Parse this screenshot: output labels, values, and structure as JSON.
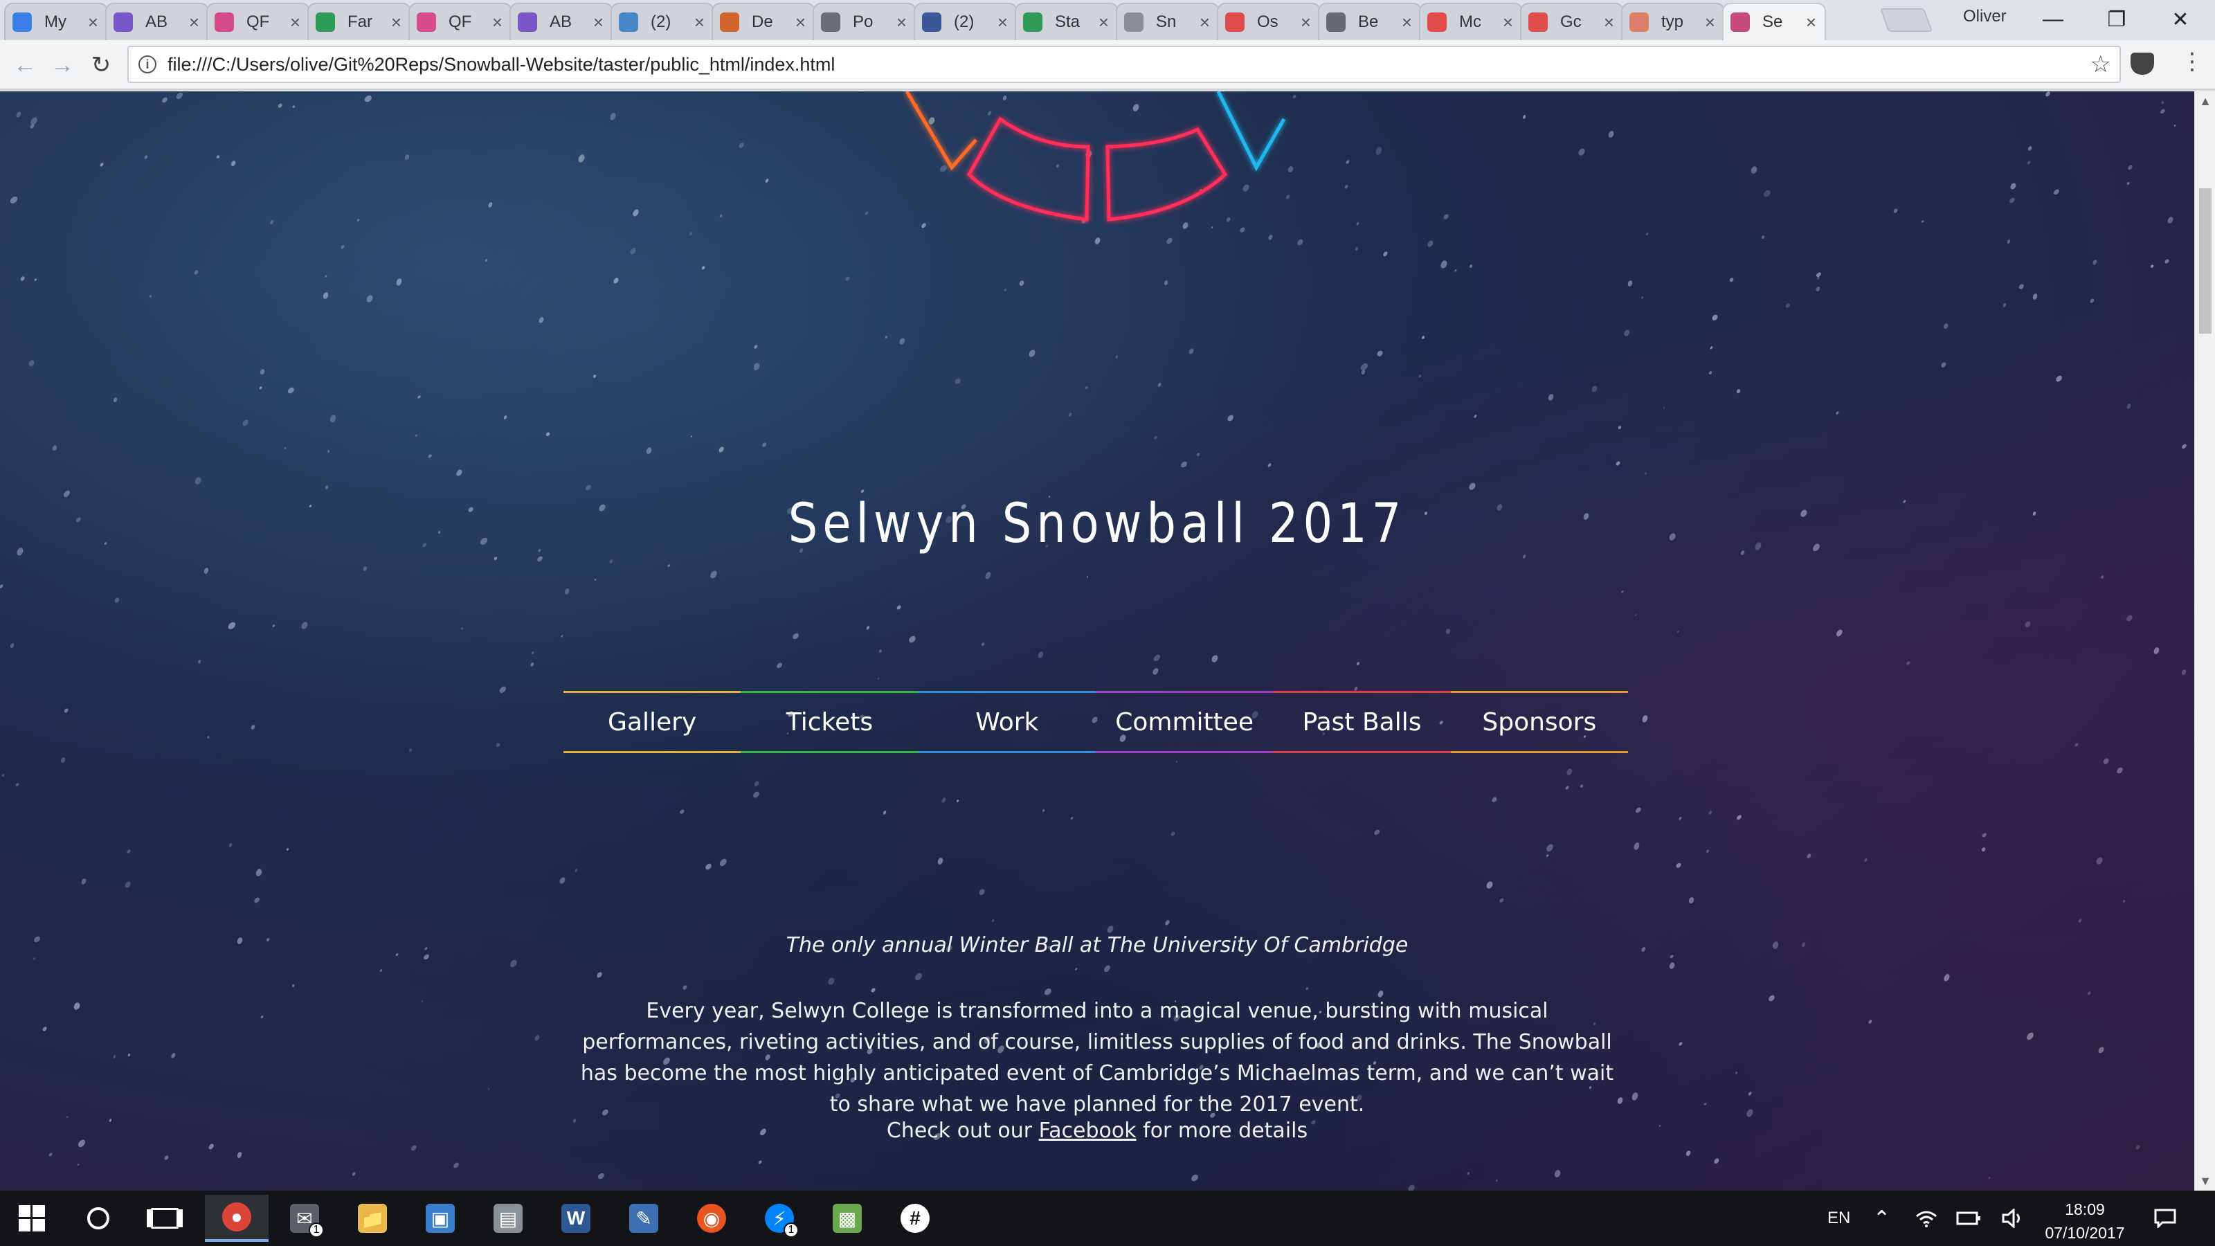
{
  "browser": {
    "tabs": [
      {
        "label": "My",
        "icon": "drive-icon",
        "color": "#3a7ee8"
      },
      {
        "label": "AB",
        "icon": "forms-icon",
        "color": "#7b57c9"
      },
      {
        "label": "QF",
        "icon": "qf-icon",
        "color": "#d44c8a"
      },
      {
        "label": "Far",
        "icon": "sheets-icon",
        "color": "#2e9c58"
      },
      {
        "label": "QF",
        "icon": "qf-icon",
        "color": "#d44c8a"
      },
      {
        "label": "AB",
        "icon": "forms-icon",
        "color": "#7b57c9"
      },
      {
        "label": "(2)",
        "icon": "chat-icon",
        "color": "#4a87c8"
      },
      {
        "label": "De",
        "icon": "shield-icon",
        "color": "#d0632e"
      },
      {
        "label": "Po",
        "icon": "globe-icon",
        "color": "#6b6f75"
      },
      {
        "label": "(2)",
        "icon": "facebook-icon",
        "color": "#3b5998"
      },
      {
        "label": "Sta",
        "icon": "sheets-icon",
        "color": "#2e9c58"
      },
      {
        "label": "Sn",
        "icon": "lock-icon",
        "color": "#8a8f96"
      },
      {
        "label": "Os",
        "icon": "f-icon",
        "color": "#e04b4b"
      },
      {
        "label": "Be",
        "icon": "page-icon",
        "color": "#666a70"
      },
      {
        "label": "Mc",
        "icon": "f-icon",
        "color": "#e04b4b"
      },
      {
        "label": "Gc",
        "icon": "f-icon",
        "color": "#e04b4b"
      },
      {
        "label": "typ",
        "icon": "circle-icon",
        "color": "#e07c6a"
      },
      {
        "label": "Se",
        "icon": "snowball-icon",
        "color": "#c84a7a"
      }
    ],
    "profile_name": "Oliver",
    "url": "file:///C:/Users/olive/Git%20Reps/Snowball-Website/taster/public_html/index.html"
  },
  "page": {
    "title": "Selwyn Snowball 2017",
    "nav": [
      {
        "label": "Gallery",
        "color": "#e8b23a"
      },
      {
        "label": "Tickets",
        "color": "#39b54a"
      },
      {
        "label": "Work",
        "color": "#2f8ee0"
      },
      {
        "label": "Committee",
        "color": "#9b3fc7"
      },
      {
        "label": "Past Balls",
        "color": "#e23a4a"
      },
      {
        "label": "Sponsors",
        "color": "#e89a2a"
      }
    ],
    "tagline": "The only annual Winter Ball at The University Of Cambridge",
    "blurb": "Every year, Selwyn College is transformed into a magical venue, bursting with musical performances, riveting activities, and of course, limitless supplies of food and drinks. The Snowball has become the most highly anticipated event of Cambridge’s Michaelmas term, and we can’t wait to share what we have planned for the 2017 event.",
    "cta_prefix": "Check out our",
    "cta_link": "Facebook",
    "cta_suffix": "for more details"
  },
  "taskbar": {
    "apps": [
      {
        "name": "chrome-icon",
        "active": true,
        "badge": ""
      },
      {
        "name": "mail-icon",
        "active": false,
        "badge": "1"
      },
      {
        "name": "file-explorer-icon",
        "active": false,
        "badge": ""
      },
      {
        "name": "control-panel-icon",
        "active": false,
        "badge": ""
      },
      {
        "name": "scanner-icon",
        "active": false,
        "badge": ""
      },
      {
        "name": "word-icon",
        "active": false,
        "badge": ""
      },
      {
        "name": "drawing-icon",
        "active": false,
        "badge": ""
      },
      {
        "name": "ubuntu-icon",
        "active": false,
        "badge": ""
      },
      {
        "name": "messenger-icon",
        "active": false,
        "badge": "1"
      },
      {
        "name": "minecraft-icon",
        "active": false,
        "badge": ""
      },
      {
        "name": "slack-icon",
        "active": false,
        "badge": ""
      }
    ],
    "language": "EN",
    "time": "18:09",
    "date": "07/10/2017"
  }
}
